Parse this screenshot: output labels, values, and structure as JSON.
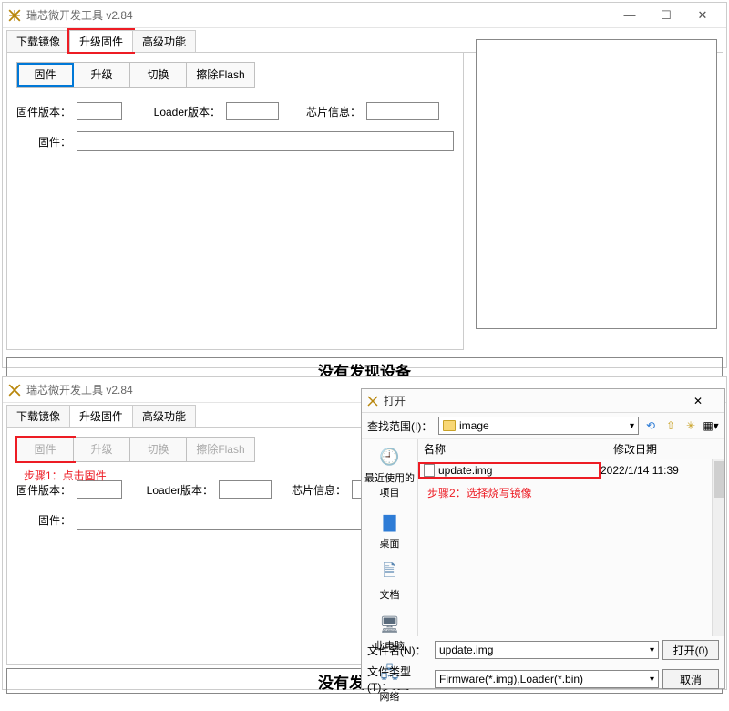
{
  "win1": {
    "title": "瑞芯微开发工具 v2.84",
    "tabs": [
      "下载镜像",
      "升级固件",
      "高级功能"
    ],
    "active_tab": 1,
    "buttons": [
      "固件",
      "升级",
      "切换",
      "擦除Flash"
    ],
    "labels": {
      "fw_ver": "固件版本：",
      "loader_ver": "Loader版本：",
      "chip_info": "芯片信息：",
      "fw": "固件："
    },
    "status": "没有发现设备"
  },
  "win2": {
    "title": "瑞芯微开发工具 v2.84",
    "tabs": [
      "下载镜像",
      "升级固件",
      "高级功能"
    ],
    "active_tab": 1,
    "buttons": [
      "固件",
      "升级",
      "切换",
      "擦除Flash"
    ],
    "labels": {
      "fw_ver": "固件版本：",
      "loader_ver": "Loader版本：",
      "chip_info": "芯片信息：",
      "fw": "固件："
    },
    "status": "没有发现设备",
    "step1": "步骤1：点击固件"
  },
  "opendlg": {
    "title": "打开",
    "look_in_label": "查找范围(I)：",
    "look_in_value": "image",
    "places": [
      {
        "icon": "⏱",
        "label": "最近使用的项目"
      },
      {
        "icon": "■",
        "label": "桌面",
        "color": "#2e7cd6"
      },
      {
        "icon": "🗎",
        "label": "文档"
      },
      {
        "icon": "🖥",
        "label": "此电脑"
      },
      {
        "icon": "🌐",
        "label": "网络"
      }
    ],
    "cols": {
      "name": "名称",
      "mdate": "修改日期"
    },
    "files": [
      {
        "name": "update.img",
        "date": "2022/1/14 11:39"
      }
    ],
    "step2": "步骤2：选择烧写镜像",
    "filename_label": "文件名(N)：",
    "filename_value": "update.img",
    "filetype_label": "文件类型(T)：",
    "filetype_value": "Firmware(*.img),Loader(*.bin)",
    "open_btn": "打开(0)",
    "cancel_btn": "取消"
  }
}
